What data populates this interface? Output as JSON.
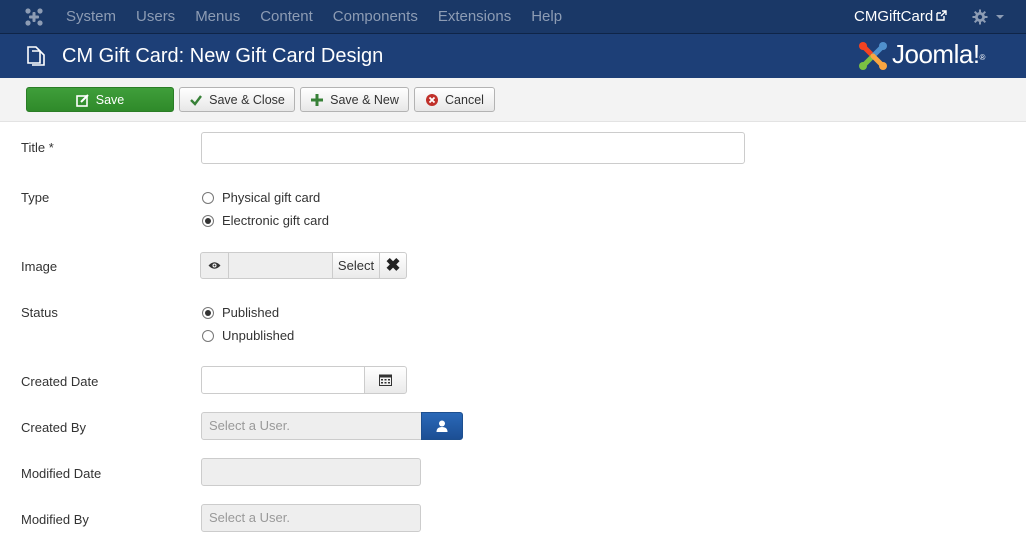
{
  "navbar": {
    "menu": [
      "System",
      "Users",
      "Menus",
      "Content",
      "Components",
      "Extensions",
      "Help"
    ],
    "site_name": "CMGiftCard",
    "external_icon": "external-link-icon",
    "settings_icon": "gear-icon"
  },
  "header": {
    "title": "CM Gift Card: New Gift Card Design",
    "brand": "Joomla!",
    "page_icon": "copy-icon"
  },
  "toolbar": {
    "save": "Save",
    "save_close": "Save & Close",
    "save_new": "Save & New",
    "cancel": "Cancel"
  },
  "form": {
    "title_label": "Title *",
    "title_value": "",
    "type_label": "Type",
    "type_options": [
      "Physical gift card",
      "Electronic gift card"
    ],
    "type_selected": "Electronic gift card",
    "image_label": "Image",
    "image_select": "Select",
    "status_label": "Status",
    "status_options": [
      "Published",
      "Unpublished"
    ],
    "status_selected": "Published",
    "created_date_label": "Created Date",
    "created_by_label": "Created By",
    "created_by_placeholder": "Select a User.",
    "modified_date_label": "Modified Date",
    "modified_by_label": "Modified By",
    "modified_by_placeholder": "Select a User."
  },
  "colors": {
    "navbar": "#1a3867",
    "header": "#1d3f77",
    "save_button": "#3a9636",
    "user_button": "#2a69b8",
    "cancel_icon": "#c0302a"
  }
}
